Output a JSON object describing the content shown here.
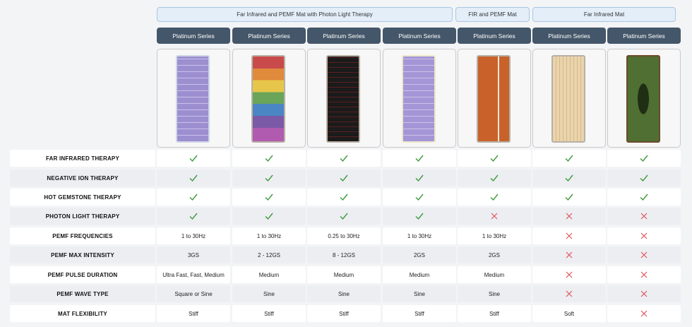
{
  "group_headers": [
    {
      "label": "Far Infrared and PEMF Mat with Photon Light Therapy"
    },
    {
      "label": "FIR and PEMF Mat"
    },
    {
      "label": "Far Infrared Mat"
    }
  ],
  "products": [
    {
      "series": "Platinum Series",
      "mat": "purple",
      "mat_color": "#9c8fd0"
    },
    {
      "series": "Platinum Series",
      "mat": "rainbow",
      "mat_color": "#d9a16a"
    },
    {
      "series": "Platinum Series",
      "mat": "black",
      "mat_color": "#1b1b1b"
    },
    {
      "series": "Platinum Series",
      "mat": "purple-cream",
      "mat_color": "#a496d6"
    },
    {
      "series": "Platinum Series",
      "mat": "copper",
      "mat_color": "#c8622a"
    },
    {
      "series": "Platinum Series",
      "mat": "bamboo",
      "mat_color": "#e8cfa3"
    },
    {
      "series": "Platinum Series",
      "mat": "green-jade",
      "mat_color": "#3f5a2a"
    }
  ],
  "rows": [
    {
      "label": "FAR INFRARED THERAPY",
      "cells": [
        "check",
        "check",
        "check",
        "check",
        "check",
        "check",
        "check"
      ]
    },
    {
      "label": "NEGATIVE ION THERAPY",
      "cells": [
        "check",
        "check",
        "check",
        "check",
        "check",
        "check",
        "check"
      ]
    },
    {
      "label": "HOT GEMSTONE THERAPY",
      "cells": [
        "check",
        "check",
        "check",
        "check",
        "check",
        "check",
        "check"
      ]
    },
    {
      "label": "PHOTON LIGHT THERAPY",
      "cells": [
        "check",
        "check",
        "check",
        "check",
        "cross",
        "cross",
        "cross"
      ]
    },
    {
      "label": "PEMF FREQUENCIES",
      "cells": [
        "1 to 30Hz",
        "1 to 30Hz",
        "0.25 to 30Hz",
        "1 to 30Hz",
        "1 to 30Hz",
        "cross",
        "cross"
      ]
    },
    {
      "label": "PEMF MAX INTENSITY",
      "cells": [
        "3GS",
        "2 - 12GS",
        "8 - 12GS",
        "2GS",
        "2GS",
        "cross",
        "cross"
      ]
    },
    {
      "label": "PEMF PULSE DURATION",
      "cells": [
        "Ultra Fast, Fast, Medium",
        "Medium",
        "Medium",
        "Medium",
        "Medium",
        "cross",
        "cross"
      ]
    },
    {
      "label": "PEMF WAVE TYPE",
      "cells": [
        "Square or Sine",
        "Sine",
        "Sine",
        "Sine",
        "Sine",
        "cross",
        "cross"
      ]
    },
    {
      "label": "MAT FLEXIBILITY",
      "cells": [
        "Stiff",
        "Stiff",
        "Stiff",
        "Stiff",
        "Stiff",
        "Soft",
        "cross"
      ]
    }
  ],
  "colors": {
    "check": "#3c9a3c",
    "cross": "#e0545a",
    "series_bg": "#445669",
    "header_bg": "#e3eef9"
  }
}
